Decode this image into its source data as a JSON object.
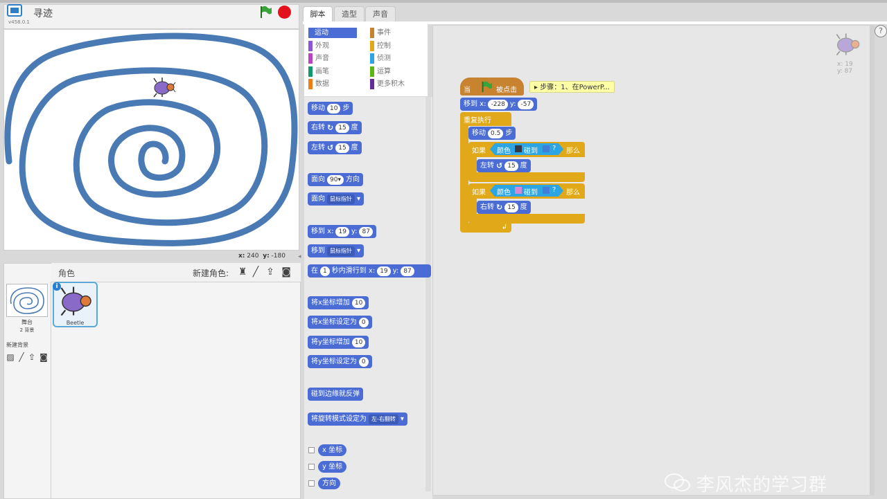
{
  "header": {
    "project_title": "寻迹",
    "version": "v458.0.1"
  },
  "stage": {
    "mouse_x_label": "x:",
    "mouse_x": "240",
    "mouse_y_label": "y:",
    "mouse_y": "-180"
  },
  "sprites_panel": {
    "label": "角色",
    "new_sprite_label": "新建角色:",
    "stage_name": "舞台",
    "backdrop_count": "2 背景",
    "new_backdrop_label": "新建背景",
    "sprite_name": "Beetle",
    "info": "i"
  },
  "tabs": {
    "scripts": "脚本",
    "costumes": "造型",
    "sounds": "声音"
  },
  "categories": {
    "left": [
      "运动",
      "外观",
      "声音",
      "画笔",
      "数据"
    ],
    "right": [
      "事件",
      "控制",
      "侦测",
      "运算",
      "更多积木"
    ],
    "selected": "运动",
    "colors": {
      "运动": "#4a6cd4",
      "外观": "#8a55d7",
      "声音": "#bb42c3",
      "画笔": "#0e9a6c",
      "数据": "#ee7d16",
      "事件": "#c88330",
      "控制": "#e1a91a",
      "侦测": "#2ca5e2",
      "运算": "#5cb712",
      "更多积木": "#632d99"
    }
  },
  "palette": {
    "move": {
      "a": "移动",
      "v": "10",
      "b": "步"
    },
    "turn_right": {
      "a": "右转",
      "v": "15",
      "b": "度"
    },
    "turn_left": {
      "a": "左转",
      "v": "15",
      "b": "度"
    },
    "point_dir": {
      "a": "面向",
      "v": "90▾",
      "b": "方向"
    },
    "point_towards": {
      "a": "面向",
      "v": "鼠标指针"
    },
    "goto_xy": {
      "a": "移到 x:",
      "x": "19",
      "b": "y:",
      "y": "87"
    },
    "goto": {
      "a": "移到",
      "v": "鼠标指针"
    },
    "glide": {
      "a": "在",
      "secs": "1",
      "b": "秒内滑行到 x:",
      "x": "19",
      "c": "y:",
      "y": "87"
    },
    "change_x": {
      "a": "将x坐标增加",
      "v": "10"
    },
    "set_x": {
      "a": "将x坐标设定为",
      "v": "0"
    },
    "change_y": {
      "a": "将y坐标增加",
      "v": "10"
    },
    "set_y": {
      "a": "将y坐标设定为",
      "v": "0"
    },
    "bounce": "碰到边缘就反弹",
    "rotation_style": {
      "a": "将旋转模式设定为",
      "v": "左-右翻转"
    },
    "reporters": [
      "x 坐标",
      "y 坐标",
      "方向"
    ]
  },
  "script": {
    "hat": {
      "a": "当",
      "b": "被点击"
    },
    "comment": "步骤：1、在PowerP...",
    "goto": {
      "a": "移到 x:",
      "x": "-228",
      "b": "y:",
      "y": "-57"
    },
    "forever": "重复执行",
    "move": {
      "a": "移动",
      "v": "0.5",
      "b": "步"
    },
    "if1": {
      "a": "如果",
      "c1": "颜色",
      "c2": "碰到",
      "c3": "?",
      "then": "那么",
      "color1": "#333a4a",
      "color2": "#3f7fd6"
    },
    "turn_left": {
      "a": "左转",
      "v": "15",
      "b": "度"
    },
    "if2": {
      "a": "如果",
      "c1": "颜色",
      "c2": "碰到",
      "c3": "?",
      "then": "那么",
      "color1": "#d48ad6",
      "color2": "#3f7fd6"
    },
    "turn_right": {
      "a": "右转",
      "v": "15",
      "b": "度"
    }
  },
  "sprite_info": {
    "x_label": "x:",
    "x": "19",
    "y_label": "y:",
    "y": "87"
  },
  "help": "?",
  "watermark": "李风杰的学习群"
}
